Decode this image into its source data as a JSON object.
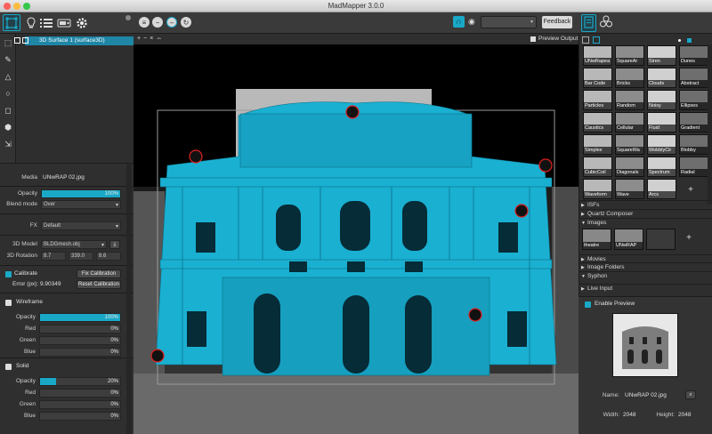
{
  "window": {
    "title": "MadMapper 3.0.0"
  },
  "toolbar": {
    "feedback_label": "Feedback",
    "left_icons": [
      "surface-editor-icon",
      "bulb-icon",
      "list-icon",
      "projector-icon",
      "gear-icon"
    ],
    "round_buttons": [
      "menu-icon",
      "minus-icon",
      "clock-icon",
      "rotate-icon"
    ]
  },
  "surfaces": {
    "add_tools": [
      "+",
      "−",
      "×",
      "⇔"
    ],
    "preview_output_label": "Preview Output",
    "items": [
      {
        "label": "3D Surface 1 (surface3D)"
      }
    ]
  },
  "props": {
    "media_label": "Media",
    "media_value": "UNwRAP 02.jpg",
    "opacity_label": "Opacity",
    "opacity_value": "100%",
    "opacity_fraction": 1.0,
    "blend_label": "Blend mode",
    "blend_value": "Over",
    "fx_label": "FX",
    "fx_value": "Default",
    "model_label": "3D Model",
    "model_value": "BLDGmesh.obj",
    "rotation_label": "3D Rotation",
    "rotation_values": [
      "8.7",
      "339.0",
      "8.6"
    ],
    "calibrate_label": "Calibrate",
    "fix_calibration": "Fix Calibration",
    "error_label": "Error (px):",
    "error_value": "9.90349",
    "reset_calibration": "Reset Calibration",
    "wireframe": {
      "title": "Wireframe",
      "rows": [
        {
          "label": "Opacity",
          "value": "100%",
          "fraction": 1.0
        },
        {
          "label": "Red",
          "value": "0%",
          "fraction": 0
        },
        {
          "label": "Green",
          "value": "0%",
          "fraction": 0
        },
        {
          "label": "Blue",
          "value": "0%",
          "fraction": 0
        }
      ]
    },
    "solid": {
      "title": "Solid",
      "rows": [
        {
          "label": "Opacity",
          "value": "20%",
          "fraction": 0.2
        },
        {
          "label": "Red",
          "value": "0%",
          "fraction": 0
        },
        {
          "label": "Green",
          "value": "0%",
          "fraction": 0
        },
        {
          "label": "Blue",
          "value": "0%",
          "fraction": 0
        }
      ]
    }
  },
  "library": {
    "generators": [
      "UNwRapea",
      "SquareAr",
      "Siren",
      "Dunes",
      "Bar Code",
      "Bricks",
      "Clouds",
      "Abstract",
      "Particles",
      "Random",
      "Noisy",
      "Ellipses",
      "Caustics",
      "Cellular",
      "Fluid",
      "Gradient",
      "Simplex",
      "SquareWa",
      "WobblyCir",
      "Blobby",
      "CubicCoil",
      "Diagonals",
      "Spectrum",
      "Radial",
      "Waveform",
      "Wave",
      "Arcs"
    ],
    "sections": [
      {
        "label": "ISFs",
        "open": false
      },
      {
        "label": "Quartz Composer",
        "open": false
      },
      {
        "label": "Images",
        "open": true
      },
      {
        "label": "Movies",
        "open": false
      },
      {
        "label": "Image Folders",
        "open": false
      },
      {
        "label": "Syphon",
        "open": true
      },
      {
        "label": "Live Input",
        "open": false
      }
    ],
    "images": [
      "theatre",
      "UNwRAP"
    ],
    "add_label": "+"
  },
  "preview": {
    "enable_label": "Enable Preview",
    "name_label": "Name:",
    "name_value": "UNwRAP 02.jpg",
    "width_label": "Width:",
    "width_value": "2048",
    "height_label": "Height:",
    "height_value": "2048"
  },
  "colors": {
    "accent": "#1aa8c7",
    "building": "#1ab0d2",
    "handle": "#e02020"
  }
}
